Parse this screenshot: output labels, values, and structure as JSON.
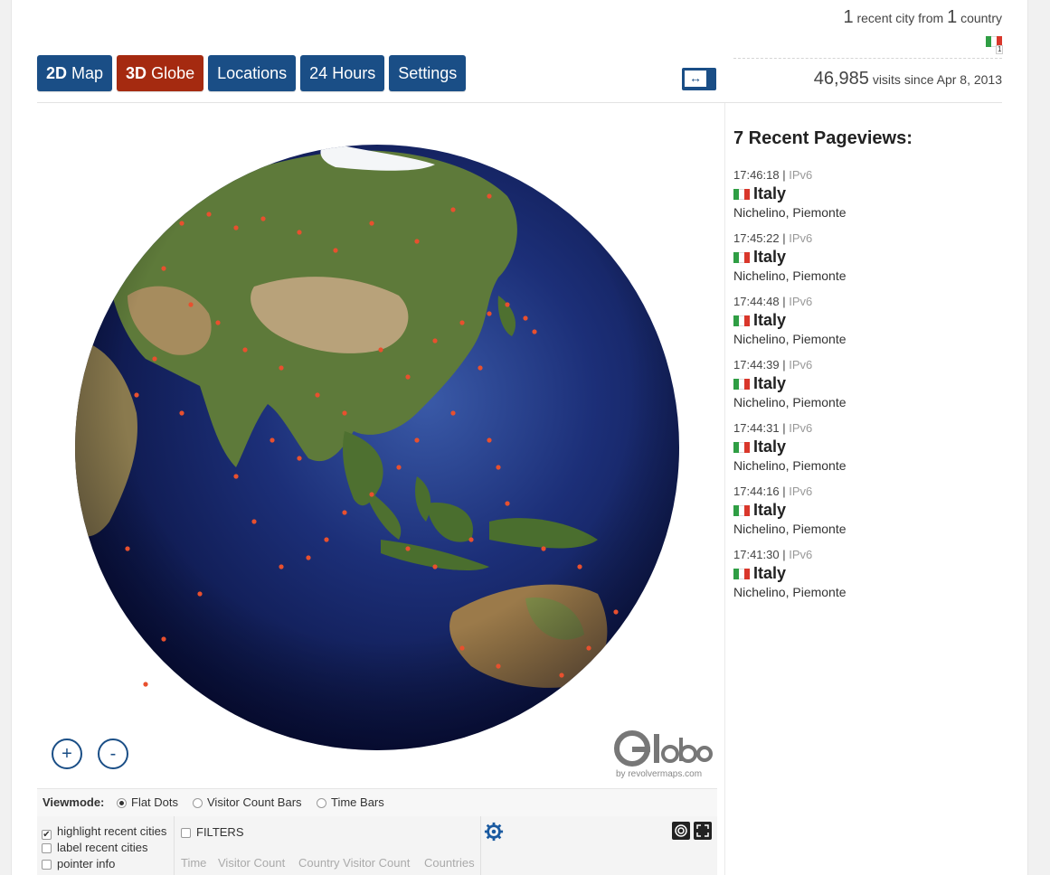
{
  "header": {
    "recent_cities": "1",
    "recent_cities_text": "recent city from",
    "countries": "1",
    "countries_text": "country",
    "flag_count": "1",
    "visits": "46,985",
    "visits_text": "visits since Apr 8, 2013"
  },
  "tabs": [
    {
      "label_bold": "2D",
      "label": " Map"
    },
    {
      "label_bold": "3D",
      "label": " Globe"
    },
    {
      "label_bold": "",
      "label": "Locations"
    },
    {
      "label_bold": "",
      "label": "24 Hours"
    },
    {
      "label_bold": "",
      "label": "Settings"
    }
  ],
  "expand_glyph": "↔",
  "zoom": {
    "in": "+",
    "out": "-"
  },
  "logo": {
    "brand": "Globe",
    "byline": "by revolvermaps.com"
  },
  "viewmode": {
    "label": "Viewmode:",
    "options": [
      "Flat Dots",
      "Visitor Count Bars",
      "Time Bars"
    ],
    "selected": "Flat Dots"
  },
  "options": {
    "highlight": "highlight recent cities",
    "label_cities": "label recent cities",
    "pointer": "pointer info",
    "filters": "FILTERS",
    "filter_tabs": [
      "Time",
      "Visitor Count",
      "Country Visitor Count",
      "Countries"
    ]
  },
  "recent": {
    "title": "7 Recent Pageviews:",
    "items": [
      {
        "time": "17:46:18",
        "ip": "IPv6",
        "country": "Italy",
        "city": "Nichelino, Piemonte"
      },
      {
        "time": "17:45:22",
        "ip": "IPv6",
        "country": "Italy",
        "city": "Nichelino, Piemonte"
      },
      {
        "time": "17:44:48",
        "ip": "IPv6",
        "country": "Italy",
        "city": "Nichelino, Piemonte"
      },
      {
        "time": "17:44:39",
        "ip": "IPv6",
        "country": "Italy",
        "city": "Nichelino, Piemonte"
      },
      {
        "time": "17:44:31",
        "ip": "IPv6",
        "country": "Italy",
        "city": "Nichelino, Piemonte"
      },
      {
        "time": "17:44:16",
        "ip": "IPv6",
        "country": "Italy",
        "city": "Nichelino, Piemonte"
      },
      {
        "time": "17:41:30",
        "ip": "IPv6",
        "country": "Italy",
        "city": "Nichelino, Piemonte"
      }
    ]
  },
  "colors": {
    "tab": "#1a4e86",
    "tab_active": "#a52a10",
    "dot": "#e8502e",
    "flag_green": "#2f9e44",
    "flag_red": "#d9372b"
  },
  "icons": [
    "expand-icon",
    "gear-icon",
    "target-icon",
    "fullscreen-icon",
    "globe-logo-icon",
    "italy-flag-icon"
  ]
}
